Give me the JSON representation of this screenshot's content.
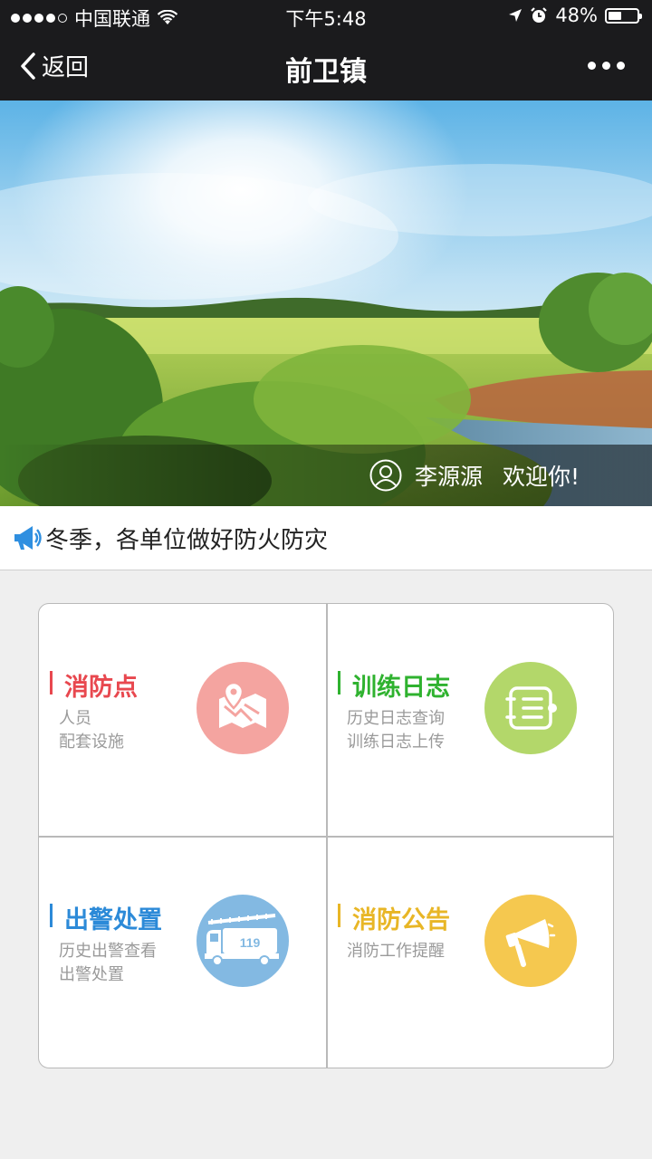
{
  "status_bar": {
    "carrier": "中国联通",
    "time": "下午5:48",
    "battery_percent": "48%",
    "battery_level": 0.48,
    "icons": [
      "signal-dots-icon",
      "wifi-icon",
      "location-arrow-icon",
      "alarm-icon",
      "battery-icon"
    ]
  },
  "nav": {
    "back_label": "返回",
    "title": "前卫镇",
    "icons": [
      "chevron-left-icon",
      "more-icon"
    ]
  },
  "banner": {
    "user_name": "李源源",
    "greeting": "欢迎你!",
    "icons": [
      "user-icon"
    ]
  },
  "notice": {
    "text": "冬季，各单位做好防火防灾",
    "icons": [
      "megaphone-icon"
    ]
  },
  "tiles": [
    {
      "title": "消防点",
      "lines": [
        "人员",
        "配套设施"
      ],
      "color": "#e8484f",
      "circle_color": "#f4a4a0",
      "icon": "map-pin-icon"
    },
    {
      "title": "训练日志",
      "lines": [
        "历史日志查询",
        "训练日志上传"
      ],
      "color": "#2fb22f",
      "circle_color": "#b3d76a",
      "icon": "log-list-icon"
    },
    {
      "title": "出警处置",
      "lines": [
        "历史出警查看",
        "出警处置"
      ],
      "color": "#2c8ad8",
      "circle_color": "#83b9e2",
      "icon": "fire-truck-icon",
      "icon_text": "119"
    },
    {
      "title": "消防公告",
      "lines": [
        "消防工作提醒"
      ],
      "color": "#e8b626",
      "circle_color": "#f5c84f",
      "icon": "loudspeaker-icon"
    }
  ]
}
